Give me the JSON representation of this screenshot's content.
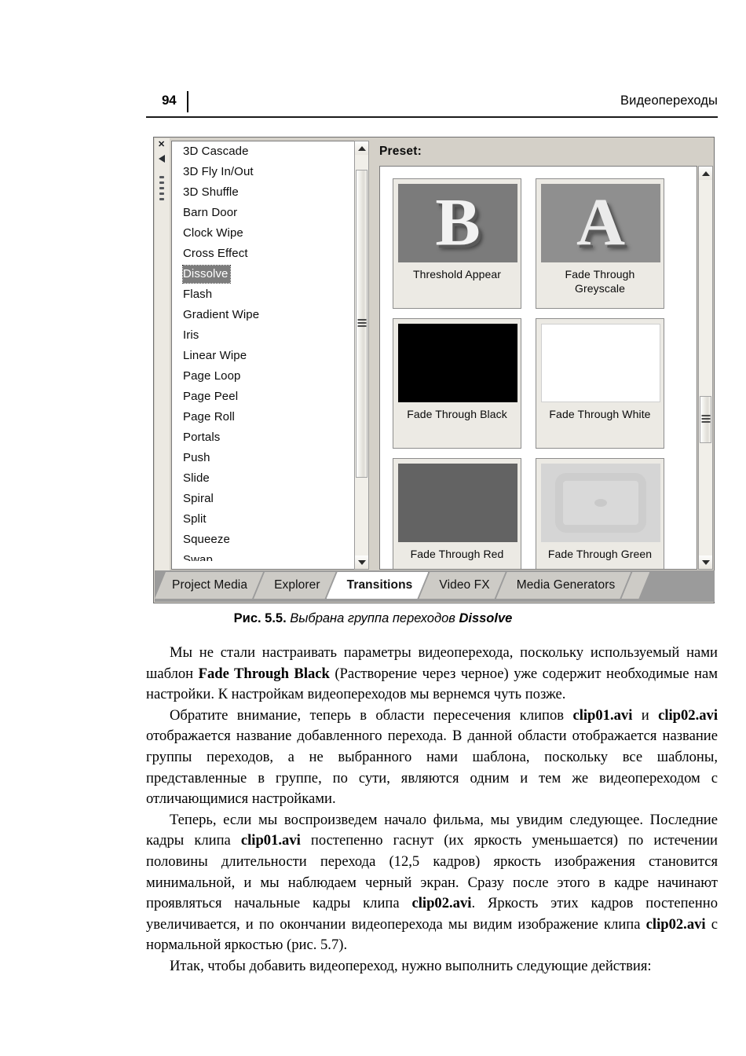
{
  "header": {
    "page_number": "94",
    "running_title": "Видеопереходы"
  },
  "figure": {
    "gutter": {
      "close_label": "✕"
    },
    "transitions_list": {
      "items": [
        "3D Cascade",
        "3D Fly In/Out",
        "3D Shuffle",
        "Barn Door",
        "Clock Wipe",
        "Cross Effect",
        "Dissolve",
        "Flash",
        "Gradient Wipe",
        "Iris",
        "Linear Wipe",
        "Page Loop",
        "Page Peel",
        "Page Roll",
        "Portals",
        "Push",
        "Slide",
        "Spiral",
        "Split",
        "Squeeze",
        "Swap"
      ],
      "selected": "Dissolve"
    },
    "preset_panel": {
      "label": "Preset:",
      "presets": [
        {
          "name": "Threshold Appear",
          "thumb": "letter-b"
        },
        {
          "name": "Fade Through Greyscale",
          "thumb": "letter-a"
        },
        {
          "name": "Fade Through Black",
          "thumb": "solid-black"
        },
        {
          "name": "Fade Through White",
          "thumb": "solid-white"
        },
        {
          "name": "Fade Through Red",
          "thumb": "solid-grey"
        },
        {
          "name": "Fade Through Green",
          "thumb": "light-scene"
        }
      ]
    },
    "tabs": [
      {
        "label": "Project Media",
        "active": false
      },
      {
        "label": "Explorer",
        "active": false
      },
      {
        "label": "Transitions",
        "active": true
      },
      {
        "label": "Video FX",
        "active": false
      },
      {
        "label": "Media Generators",
        "active": false
      }
    ]
  },
  "caption": {
    "number": "Рис. 5.5.",
    "text": " Выбрана группа переходов ",
    "bold": "Dissolve"
  },
  "body": {
    "p1_a": "Мы не стали настраивать параметры видеоперехода, поскольку используемый нами шаблон ",
    "p1_b": "Fade Through Black",
    "p1_c": " (Растворение через черное) уже содержит необходимые нам настройки. К настройкам видеопереходов мы вернемся чуть позже.",
    "p2_a": "Обратите внимание, теперь в области пересечения клипов ",
    "p2_b": "clip01.avi",
    "p2_c": " и ",
    "p2_d": "clip02.avi",
    "p2_e": " отображается название добавленного перехода. В данной области отображается название группы переходов, а не выбранного нами шаблона, поскольку все шаблоны, представленные в группе, по сути, являются одним и тем же видеопереходом с отличающимися настройками.",
    "p3_a": "Теперь, если мы воспроизведем начало фильма, мы увидим следующее. Последние кадры клипа ",
    "p3_b": "clip01.avi",
    "p3_c": " постепенно гаснут (их яркость уменьшается) по истечении половины длительности перехода (12,5 кадров) яркость изображения становится минимальной, и мы наблюдаем черный экран. Сразу после этого в кадре начинают проявляться начальные кадры клипа ",
    "p3_d": "clip02.avi",
    "p3_e": ". Яркость этих кадров постепенно увеличивается, и по окончании видеоперехода мы видим изображение клипа ",
    "p3_f": "clip02.avi",
    "p3_g": " с нормальной яркостью (рис. 5.7).",
    "p4": "Итак, чтобы добавить видеопереход, нужно выполнить следующие действия:"
  },
  "colors": {
    "window_bg": "#d4d0c8",
    "tab_inactive": "#cdcbc6",
    "tab_active": "#ffffff",
    "selection": "#7d7d7d",
    "tabbar_bg": "#9b9b9b"
  }
}
